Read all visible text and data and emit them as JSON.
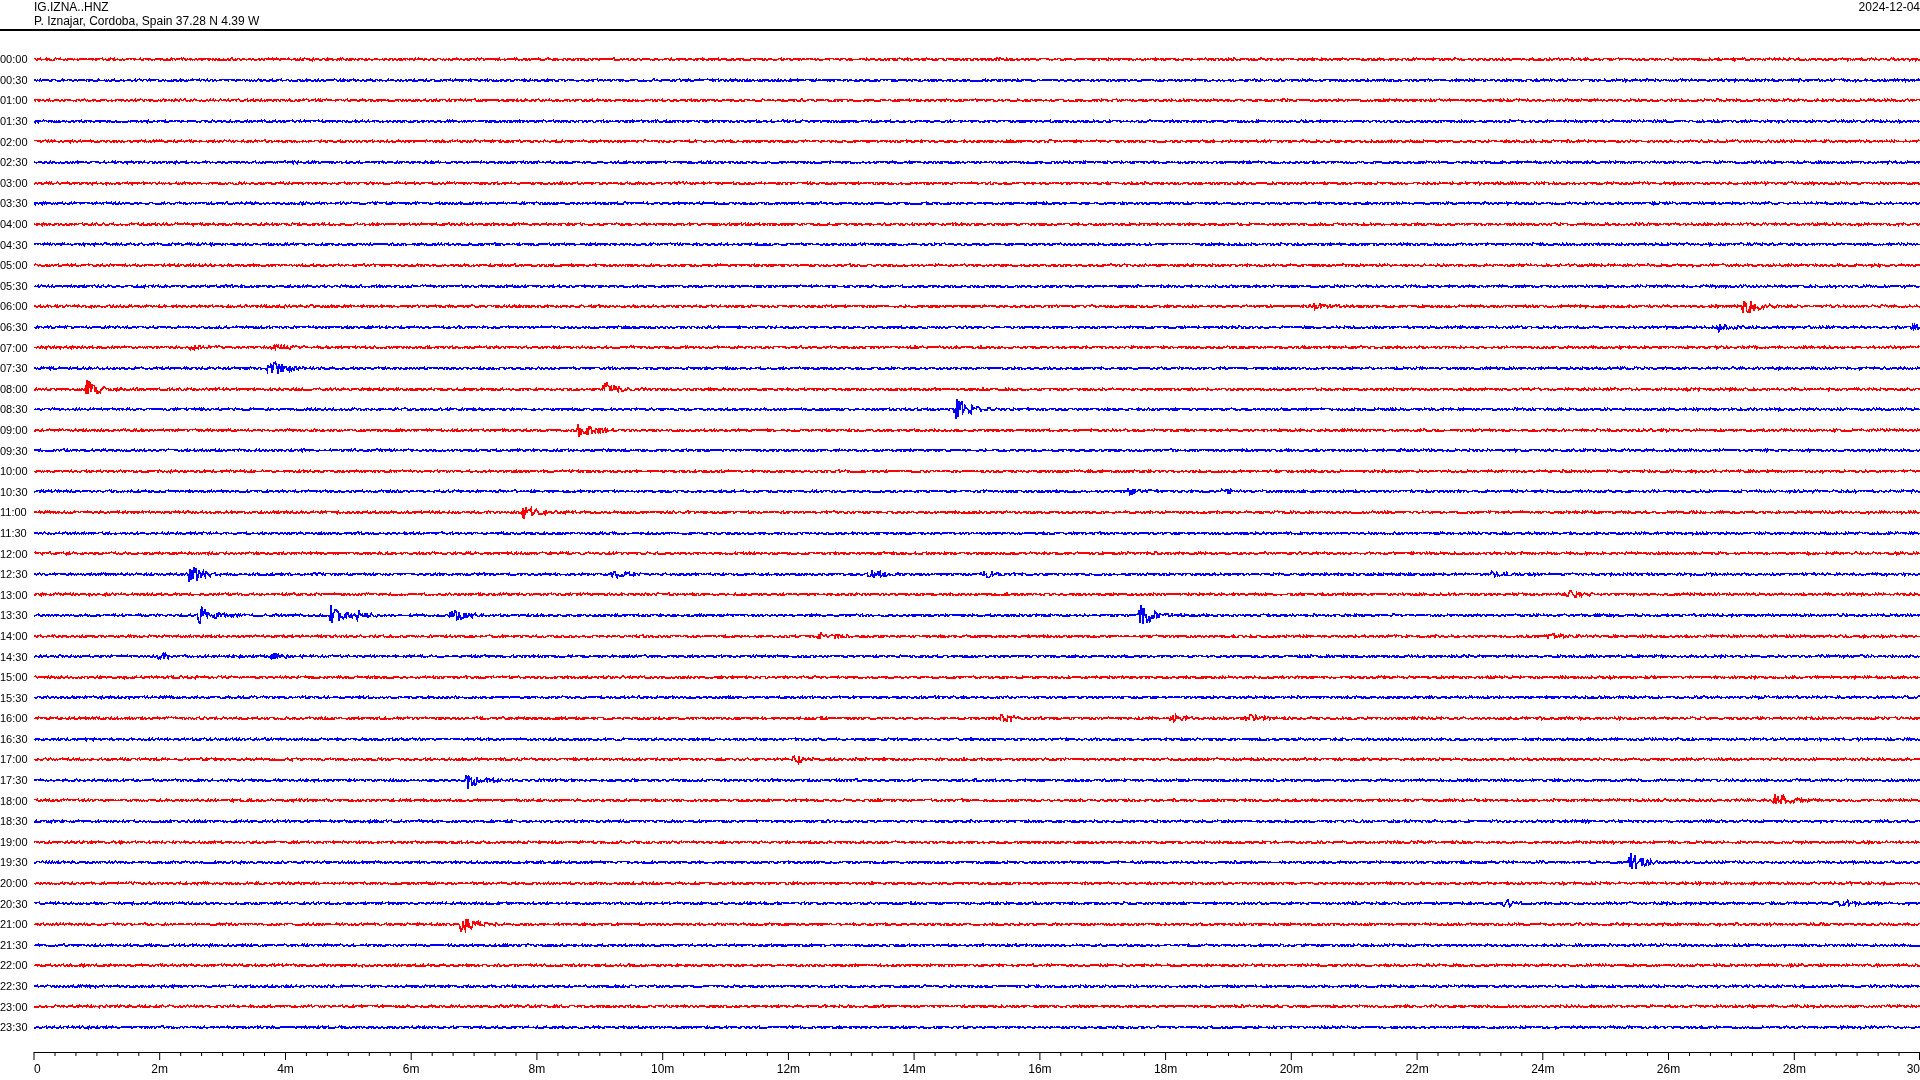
{
  "header": {
    "station": "IG.IZNA..HNZ",
    "location": "P. Iznajar, Cordoba, Spain  37.28 N 4.39 W",
    "date": "2024-12-04"
  },
  "traces": [
    {
      "time": "00:00",
      "color": "#ff0000"
    },
    {
      "time": "00:30",
      "color": "#0000ff"
    },
    {
      "time": "01:00",
      "color": "#ff0000"
    },
    {
      "time": "01:30",
      "color": "#0000ff"
    },
    {
      "time": "02:00",
      "color": "#ff0000"
    },
    {
      "time": "02:30",
      "color": "#0000ff"
    },
    {
      "time": "03:00",
      "color": "#ff0000"
    },
    {
      "time": "03:30",
      "color": "#0000ff"
    },
    {
      "time": "04:00",
      "color": "#ff0000"
    },
    {
      "time": "04:30",
      "color": "#0000ff"
    },
    {
      "time": "05:00",
      "color": "#ff0000"
    },
    {
      "time": "05:30",
      "color": "#0000ff"
    },
    {
      "time": "06:00",
      "color": "#ff0000"
    },
    {
      "time": "06:30",
      "color": "#0000ff"
    },
    {
      "time": "07:00",
      "color": "#ff0000"
    },
    {
      "time": "07:30",
      "color": "#0000ff"
    },
    {
      "time": "08:00",
      "color": "#ff0000"
    },
    {
      "time": "08:30",
      "color": "#0000ff"
    },
    {
      "time": "09:00",
      "color": "#ff0000"
    },
    {
      "time": "09:30",
      "color": "#0000ff"
    },
    {
      "time": "10:00",
      "color": "#ff0000"
    },
    {
      "time": "10:30",
      "color": "#0000ff"
    },
    {
      "time": "11:00",
      "color": "#ff0000"
    },
    {
      "time": "11:30",
      "color": "#0000ff"
    },
    {
      "time": "12:00",
      "color": "#ff0000"
    },
    {
      "time": "12:30",
      "color": "#0000ff"
    },
    {
      "time": "13:00",
      "color": "#ff0000"
    },
    {
      "time": "13:30",
      "color": "#0000ff"
    },
    {
      "time": "14:00",
      "color": "#ff0000"
    },
    {
      "time": "14:30",
      "color": "#0000ff"
    },
    {
      "time": "15:00",
      "color": "#ff0000"
    },
    {
      "time": "15:30",
      "color": "#0000ff"
    },
    {
      "time": "16:00",
      "color": "#ff0000"
    },
    {
      "time": "16:30",
      "color": "#0000ff"
    },
    {
      "time": "17:00",
      "color": "#ff0000"
    },
    {
      "time": "17:30",
      "color": "#0000ff"
    },
    {
      "time": "18:00",
      "color": "#ff0000"
    },
    {
      "time": "18:30",
      "color": "#0000ff"
    },
    {
      "time": "19:00",
      "color": "#ff0000"
    },
    {
      "time": "19:30",
      "color": "#0000ff"
    },
    {
      "time": "20:00",
      "color": "#ff0000"
    },
    {
      "time": "20:30",
      "color": "#0000ff"
    },
    {
      "time": "21:00",
      "color": "#ff0000"
    },
    {
      "time": "21:30",
      "color": "#0000ff"
    },
    {
      "time": "22:00",
      "color": "#ff0000"
    },
    {
      "time": "22:30",
      "color": "#0000ff"
    },
    {
      "time": "23:00",
      "color": "#ff0000"
    },
    {
      "time": "23:30",
      "color": "#0000ff"
    }
  ],
  "x_axis": {
    "labels": [
      "0",
      "2m",
      "4m",
      "6m",
      "8m",
      "10m",
      "12m",
      "14m",
      "16m",
      "18m",
      "20m",
      "22m",
      "24m",
      "26m",
      "28m",
      "30"
    ]
  }
}
